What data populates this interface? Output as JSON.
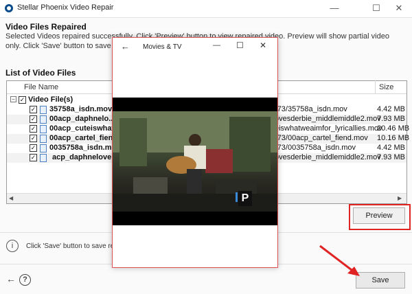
{
  "app": {
    "title": "Stellar Phoenix Video Repair",
    "window_controls": {
      "minimize": "—",
      "maximize": "☐",
      "close": "✕"
    }
  },
  "heading": "Video Files Repaired",
  "description": "Selected Videos repaired successfully. Click 'Preview' button to view repaired video. Preview will show partial video only. Click 'Save' button to save repaired videos at sel",
  "list": {
    "title": "List of Video Files",
    "columns": {
      "name": "File Name",
      "size": "Size"
    },
    "root": "Video File(s)",
    "rows": [
      {
        "name": "35758a_isdn.mov",
        "path": "-73/35758a_isdn.mov",
        "size": "4.42 MB",
        "checked": true
      },
      {
        "name": "00acp_daphnelo...",
        "path": "ovesderbie_middlemiddle2.mov",
        "size": "7.93 MB",
        "checked": true
      },
      {
        "name": "00acp_cuteiswhat.",
        "path": "eiswhatweaimfor_lyricallies.mov",
        "size": "20.46 MB",
        "checked": true
      },
      {
        "name": "00acp_cartel_fiend",
        "path": "-73/00acp_cartel_fiend.mov",
        "size": "10.16 MB",
        "checked": true
      },
      {
        "name": "0035758a_isdn.mo",
        "path": "-73/0035758a_isdn.mov",
        "size": "4.42 MB",
        "checked": true
      },
      {
        "name": "acp_daphnelove...",
        "path": "ovesderbie_middlemiddle2.mov",
        "size": "7.93 MB",
        "checked": true
      }
    ]
  },
  "buttons": {
    "preview": "Preview",
    "save": "Save"
  },
  "info_text": "Click 'Save' button to save repa",
  "icons": {
    "info": "i",
    "help": "?",
    "back": "←"
  },
  "movies_tv": {
    "title": "Movies & TV",
    "back": "←",
    "minimize": "—",
    "maximize": "☐",
    "close": "✕",
    "watermark": "P"
  },
  "colors": {
    "highlight": "#e02424",
    "arrow": "#e02424"
  }
}
